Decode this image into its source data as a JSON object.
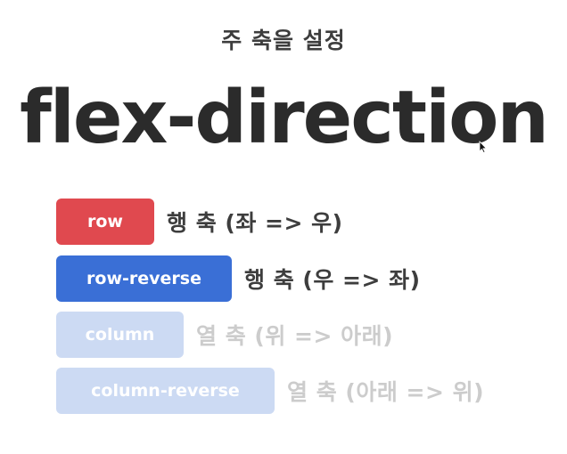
{
  "subtitle": "주 축을 설정",
  "title": "flex-direction",
  "items": [
    {
      "label": "row",
      "description": "행 축 (좌 => 우)",
      "bg": "#e0494f",
      "text_color": "#3d3d3d"
    },
    {
      "label": "row-reverse",
      "description": "행 축 (우 => 좌)",
      "bg": "#3a6fd6",
      "text_color": "#3d3d3d"
    },
    {
      "label": "column",
      "description": "열 축 (위 => 아래)",
      "bg": "#ccdaf3",
      "text_color": "#cccccc"
    },
    {
      "label": "column-reverse",
      "description": "열 축 (아래 => 위)",
      "bg": "#ccdaf3",
      "text_color": "#cccccc"
    }
  ]
}
